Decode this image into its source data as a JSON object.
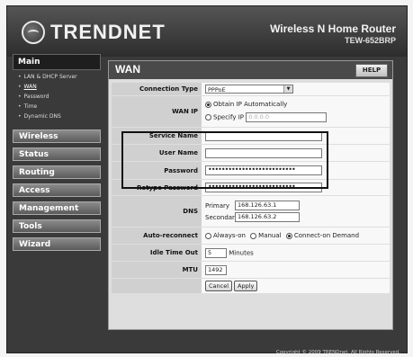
{
  "brand": {
    "logo": "TRENDNET",
    "product_name": "Wireless N Home Router",
    "model": "TEW-652BRP"
  },
  "sidebar": {
    "main_label": "Main",
    "sub_items": [
      {
        "label": "LAN & DHCP Server"
      },
      {
        "label": "WAN"
      },
      {
        "label": "Password"
      },
      {
        "label": "Time"
      },
      {
        "label": "Dynamic DNS"
      }
    ],
    "menu": [
      "Wireless",
      "Status",
      "Routing",
      "Access",
      "Management",
      "Tools",
      "Wizard"
    ]
  },
  "page": {
    "title": "WAN",
    "help_label": "HELP"
  },
  "form": {
    "connection_type": {
      "label": "Connection Type",
      "value": "PPPoE"
    },
    "wan_ip": {
      "label": "WAN IP",
      "obtain_label": "Obtain IP Automatically",
      "specify_label": "Specify IP",
      "specify_placeholder": "0.0.0.0"
    },
    "service_name": {
      "label": "Service Name",
      "value": ""
    },
    "user_name": {
      "label": "User Name",
      "value": ""
    },
    "password": {
      "label": "Password",
      "value": "••••••••••••••••••••••••••"
    },
    "retype_password": {
      "label": "Retype Password",
      "value": "••••••••••••••••••••••••••"
    },
    "dns": {
      "label": "DNS",
      "primary_label": "Primary",
      "primary_value": "168.126.63.1",
      "secondary_label": "Secondary",
      "secondary_value": "168.126.63.2"
    },
    "auto_reconnect": {
      "label": "Auto-reconnect",
      "options": [
        "Always-on",
        "Manual",
        "Connect-on Demand"
      ],
      "selected": "Connect-on Demand"
    },
    "idle_time": {
      "label": "Idle Time Out",
      "value": "5",
      "unit": "Minutes"
    },
    "mtu": {
      "label": "MTU",
      "value": "1492"
    },
    "cancel_label": "Cancel",
    "apply_label": "Apply"
  },
  "footer": {
    "copyright": "Copyright © 2009 TRENDnet. All Rights Reserved."
  }
}
